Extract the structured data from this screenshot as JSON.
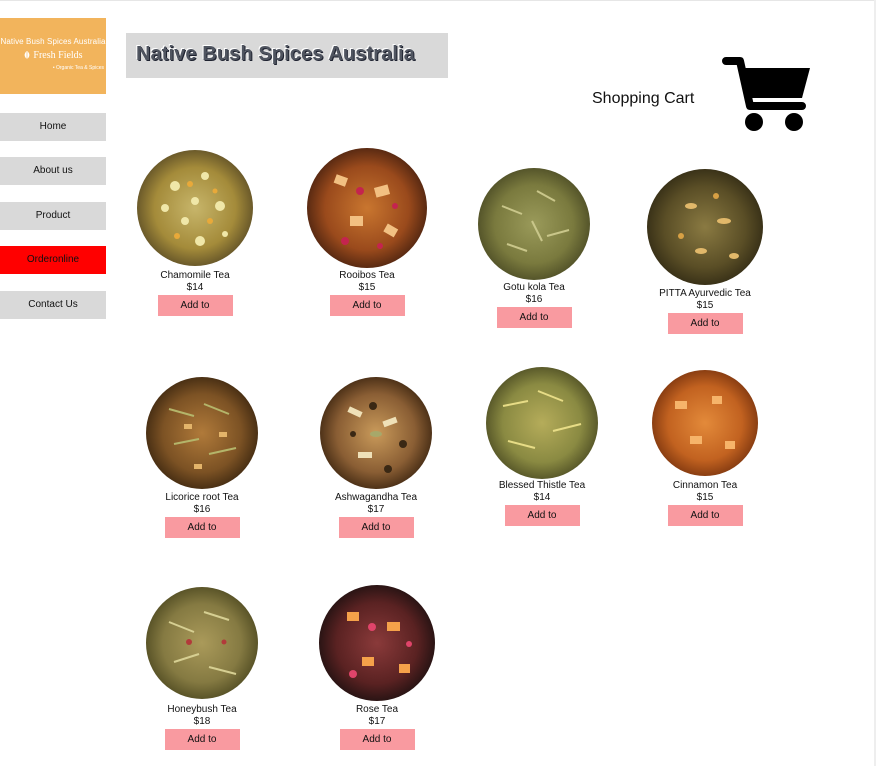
{
  "logo": {
    "line1": "Native Bush Spices Australia",
    "brand": "Fresh Fields",
    "tagline": "• Organic Tea & Spices"
  },
  "nav": [
    {
      "label": "Home"
    },
    {
      "label": "About us"
    },
    {
      "label": "Product"
    },
    {
      "label": "Orderonline",
      "active": true
    },
    {
      "label": "Contact Us"
    }
  ],
  "header": {
    "title": "Native Bush Spices Australia",
    "cart_label": "Shopping Cart",
    "cart_icon": "shopping-cart-icon"
  },
  "products": [
    {
      "name": "Chamomile Tea",
      "price": "$14",
      "button": "Add to"
    },
    {
      "name": "Rooibos Tea",
      "price": "$15",
      "button": "Add to"
    },
    {
      "name": "Gotu kola Tea",
      "price": "$16",
      "button": "Add to"
    },
    {
      "name": "PITTA Ayurvedic Tea",
      "price": "$15",
      "button": "Add to"
    },
    {
      "name": "Licorice root Tea",
      "price": "$16",
      "button": "Add to"
    },
    {
      "name": "Ashwagandha Tea",
      "price": "$17",
      "button": "Add to"
    },
    {
      "name": "Blessed Thistle Tea",
      "price": "$14",
      "button": "Add to"
    },
    {
      "name": "Cinnamon Tea",
      "price": "$15",
      "button": "Add to"
    },
    {
      "name": "Honeybush Tea",
      "price": "$18",
      "button": "Add to"
    },
    {
      "name": "Rose Tea",
      "price": "$17",
      "button": "Add to"
    }
  ],
  "colors": {
    "logo_bg": "#f2b45c",
    "nav_bg": "#d9d9d9",
    "nav_active": "#ff0000",
    "button_bg": "#f99aa0"
  }
}
